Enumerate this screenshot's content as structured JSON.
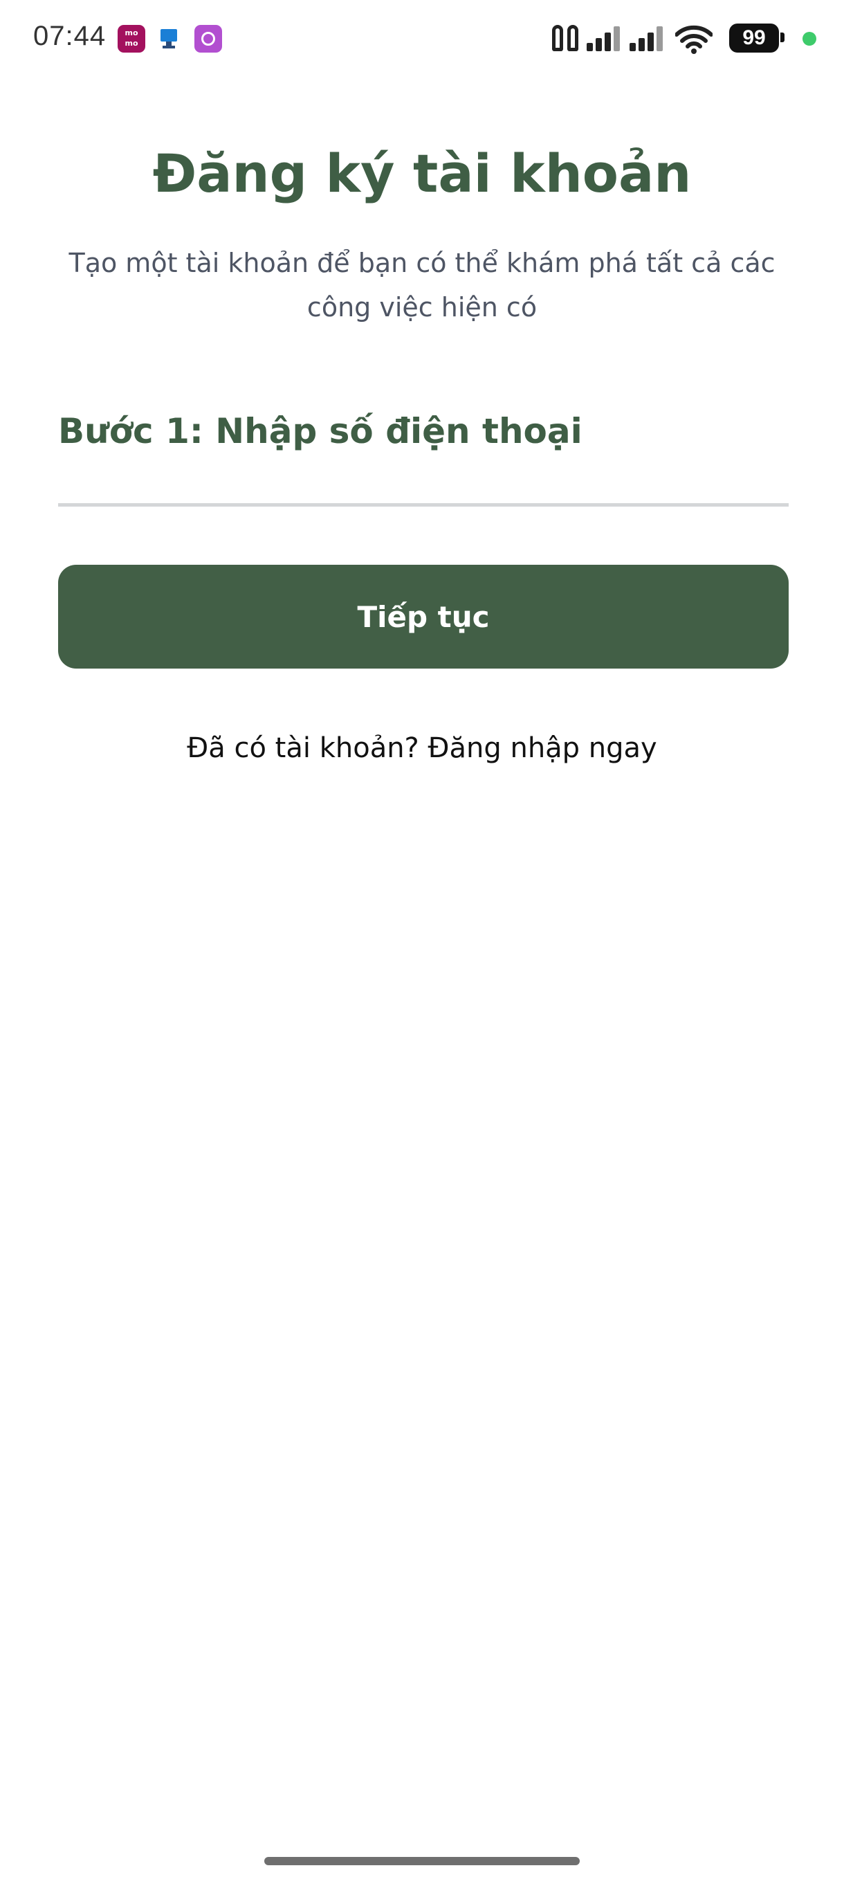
{
  "status_bar": {
    "time": "07:44",
    "notification_icons": [
      "momo-icon",
      "monitor-icon",
      "circle-app-icon"
    ],
    "momo_text": "mo mo",
    "battery_level": "99",
    "colors": {
      "momo": "#a3115e",
      "circle_app": "#b24fd0",
      "active_dot": "#3ecb6b"
    }
  },
  "header": {
    "title": "Đăng ký tài khoản",
    "subtitle": "Tạo một tài khoản để bạn có thể khám phá tất cả các công việc hiện có"
  },
  "form": {
    "step_label": "Bước 1: Nhập số điện thoại",
    "phone_value": "",
    "continue_label": "Tiếp tục"
  },
  "footer": {
    "login_prompt": "Đã có tài khoản? Đăng nhập ngay"
  },
  "theme": {
    "accent": "#425f46",
    "title_color": "#3f5e45",
    "subtitle_color": "#4e5564"
  }
}
